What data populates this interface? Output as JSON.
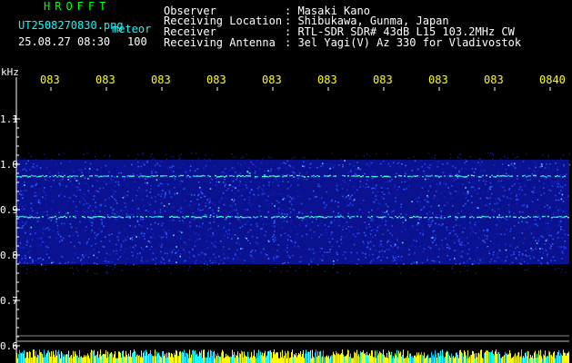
{
  "header": {
    "logo": "HROFFT",
    "filename": "UT2508270830.png",
    "tag": "meteor",
    "datetime": "25.08.27 08:30",
    "count": "100",
    "fields": [
      {
        "label": "Observer",
        "value": ": Masaki Kano"
      },
      {
        "label": "Receiving Location",
        "value": ": Shibukawa, Gunma, Japan"
      },
      {
        "label": "Receiver",
        "value": ": RTL-SDR SDR# 43dB L15 103.2MHz CW"
      },
      {
        "label": "Receiving Antenna",
        "value": ": 3el Yagi(V) Az 330 for Vladivostok"
      }
    ]
  },
  "chart_data": {
    "type": "heatmap",
    "title": "",
    "ylabel": "kHz",
    "xlabel": "",
    "ylim": [
      0.6,
      1.15
    ],
    "y_ticks": [
      "1.1",
      "1.0",
      "0.9",
      "0.8",
      "0.7",
      "0.6"
    ],
    "y_tick_values": [
      1.1,
      1.0,
      0.9,
      0.8,
      0.7,
      0.6
    ],
    "x_ticks": [
      "083",
      "083",
      "083",
      "083",
      "083",
      "083",
      "083",
      "083",
      "083",
      "0840"
    ],
    "noise_band_khz": [
      0.78,
      1.01
    ],
    "carrier_lines_khz": [
      0.975,
      0.885
    ],
    "colors": {
      "background": "#000000",
      "axis": "#ffffff",
      "tick_label": "#ffffff",
      "time_label": "#ffff00",
      "noise": "#1a2ad8",
      "carrier": "#40ffd0",
      "bottom_bar": "#ffff00"
    }
  }
}
